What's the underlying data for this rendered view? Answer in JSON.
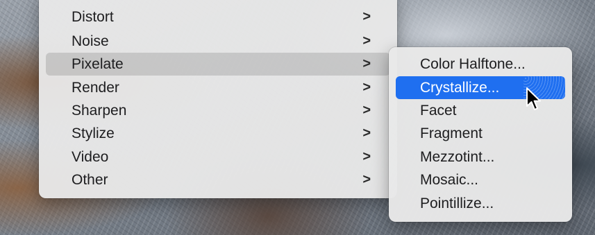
{
  "menu": {
    "items": [
      {
        "label": "Distort"
      },
      {
        "label": "Noise"
      },
      {
        "label": "Pixelate"
      },
      {
        "label": "Render"
      },
      {
        "label": "Sharpen"
      },
      {
        "label": "Stylize"
      },
      {
        "label": "Video"
      },
      {
        "label": "Other"
      }
    ],
    "submenu_indicator": ">",
    "active_item": "Pixelate"
  },
  "submenu": {
    "items": [
      {
        "label": "Color Halftone..."
      },
      {
        "label": "Crystallize..."
      },
      {
        "label": "Facet"
      },
      {
        "label": "Fragment"
      },
      {
        "label": "Mezzotint..."
      },
      {
        "label": "Mosaic..."
      },
      {
        "label": "Pointillize..."
      }
    ],
    "selected_item": "Crystallize...",
    "highlight_color": "#1f6ff0"
  },
  "cursor": {
    "icon": "arrow-pointer-icon"
  }
}
